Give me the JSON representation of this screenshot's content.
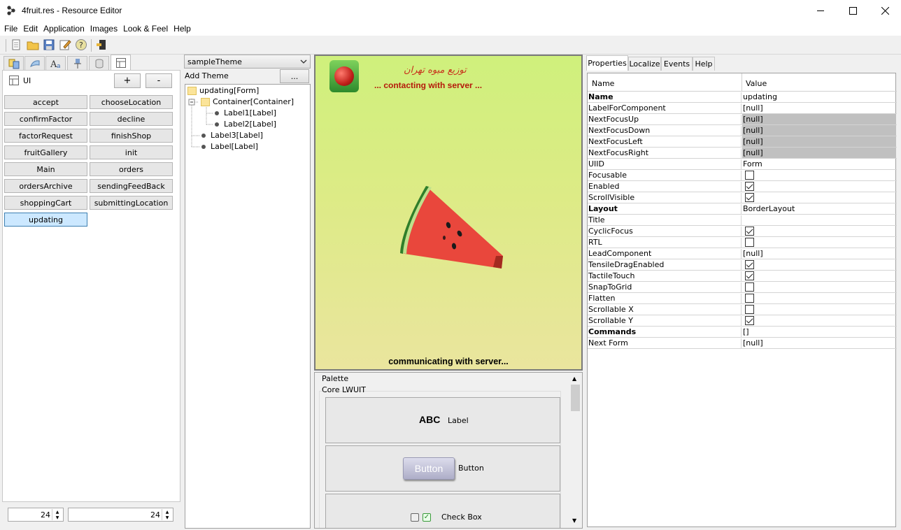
{
  "window": {
    "title": "4fruit.res - Resource Editor"
  },
  "menu": [
    "File",
    "Edit",
    "Application",
    "Images",
    "Look & Feel",
    "Help"
  ],
  "left": {
    "section_label": "UI",
    "plus_label": "+",
    "minus_label": "-",
    "forms": [
      "accept",
      "chooseLocation",
      "confirmFactor",
      "decline",
      "factorRequest",
      "finishShop",
      "fruitGallery",
      "init",
      "Main",
      "orders",
      "ordersArchive",
      "sendingFeedBack",
      "shoppingCart",
      "submittingLocation",
      "updating"
    ],
    "selected_form": "updating",
    "spinner1": "24",
    "spinner2": "24"
  },
  "theme": {
    "selected": "sampleTheme",
    "add_theme_label": "Add Theme",
    "dots_label": "...",
    "tree": [
      "updating[Form]",
      "Container[Container]",
      "Label1[Label]",
      "Label2[Label]",
      "Label3[Label]",
      "Label[Label]"
    ]
  },
  "preview": {
    "arabic_text": "توزیع میوه تهران",
    "contacting": "... contacting with server ...",
    "communicating": "communicating with server..."
  },
  "palette": {
    "title": "Palette",
    "group": "Core LWUIT",
    "label_preview": "ABC",
    "label_item": "Label",
    "button_preview": "Button",
    "button_item": "Button",
    "checkbox_item": "Check Box"
  },
  "properties": {
    "tabs": [
      "Properties",
      "Localize",
      "Events",
      "Help"
    ],
    "col_name": "Name",
    "col_value": "Value",
    "rows": [
      {
        "name": "Name",
        "value": "updating",
        "bold": true
      },
      {
        "name": "LabelForComponent",
        "value": "[null]"
      },
      {
        "name": "NextFocusUp",
        "value": "[null]",
        "grey": true
      },
      {
        "name": "NextFocusDown",
        "value": "[null]",
        "grey": true
      },
      {
        "name": "NextFocusLeft",
        "value": "[null]",
        "grey": true
      },
      {
        "name": "NextFocusRight",
        "value": "[null]",
        "grey": true
      },
      {
        "name": "UIID",
        "value": "Form"
      },
      {
        "name": "Focusable",
        "checkbox": false
      },
      {
        "name": "Enabled",
        "checkbox": true
      },
      {
        "name": "ScrollVisible",
        "checkbox": true
      },
      {
        "name": "Layout",
        "value": "BorderLayout",
        "bold": true
      },
      {
        "name": "Title",
        "value": ""
      },
      {
        "name": "CyclicFocus",
        "checkbox": true
      },
      {
        "name": "RTL",
        "checkbox": false
      },
      {
        "name": "LeadComponent",
        "value": "[null]"
      },
      {
        "name": "TensileDragEnabled",
        "checkbox": true
      },
      {
        "name": "TactileTouch",
        "checkbox": true
      },
      {
        "name": "SnapToGrid",
        "checkbox": false
      },
      {
        "name": "Flatten",
        "checkbox": false
      },
      {
        "name": "Scrollable X",
        "checkbox": false
      },
      {
        "name": "Scrollable Y",
        "checkbox": true
      },
      {
        "name": "Commands",
        "value": "[]",
        "bold": true
      },
      {
        "name": "Next Form",
        "value": "[null]"
      }
    ]
  }
}
